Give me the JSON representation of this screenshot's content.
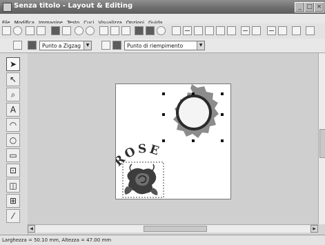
{
  "window": {
    "title": "Senza titolo - Layout & Editing"
  },
  "menu": [
    "File",
    "Modifica",
    "Immagine",
    "Testo",
    "Cuci",
    "Visualizza",
    "Opzioni",
    "Guida"
  ],
  "sewing": {
    "stitch_type": "Punto a Zigzag",
    "fill_type": "Punto di riempimento"
  },
  "design": {
    "text": "ROSE"
  },
  "status": {
    "text": "Larghezza = 50.10 mm, Altezza = 47.00 mm"
  }
}
